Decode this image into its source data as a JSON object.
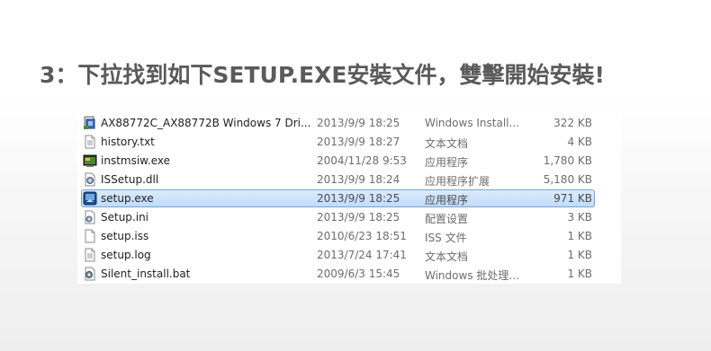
{
  "heading": "3：下拉找到如下SETUP.EXE安裝文件，雙擊開始安裝!",
  "files": [
    {
      "name": "AX88772C_AX88772B Windows 7 Dri...",
      "date": "2013/9/9 18:25",
      "type": "Windows Install...",
      "size": "322 KB",
      "icon": "installer-icon",
      "selected": false
    },
    {
      "name": "history.txt",
      "date": "2013/9/9 18:27",
      "type": "文本文档",
      "size": "4 KB",
      "icon": "text-file-icon",
      "selected": false
    },
    {
      "name": "instmsiw.exe",
      "date": "2004/11/28 9:53",
      "type": "应用程序",
      "size": "1,780 KB",
      "icon": "exe-app-icon",
      "selected": false
    },
    {
      "name": "ISSetup.dll",
      "date": "2013/9/9 18:24",
      "type": "应用程序扩展",
      "size": "5,180 KB",
      "icon": "dll-gear-icon",
      "selected": false
    },
    {
      "name": "setup.exe",
      "date": "2013/9/9 18:25",
      "type": "应用程序",
      "size": "971 KB",
      "icon": "setup-exe-icon",
      "selected": true
    },
    {
      "name": "Setup.ini",
      "date": "2013/9/9 18:25",
      "type": "配置设置",
      "size": "3 KB",
      "icon": "ini-settings-icon",
      "selected": false
    },
    {
      "name": "setup.iss",
      "date": "2010/6/23 18:51",
      "type": "ISS 文件",
      "size": "1 KB",
      "icon": "blank-file-icon",
      "selected": false
    },
    {
      "name": "setup.log",
      "date": "2013/7/24 17:41",
      "type": "文本文档",
      "size": "1 KB",
      "icon": "text-file-icon",
      "selected": false
    },
    {
      "name": "Silent_install.bat",
      "date": "2009/6/3 15:45",
      "type": "Windows 批处理...",
      "size": "1 KB",
      "icon": "batch-file-icon",
      "selected": false
    }
  ]
}
